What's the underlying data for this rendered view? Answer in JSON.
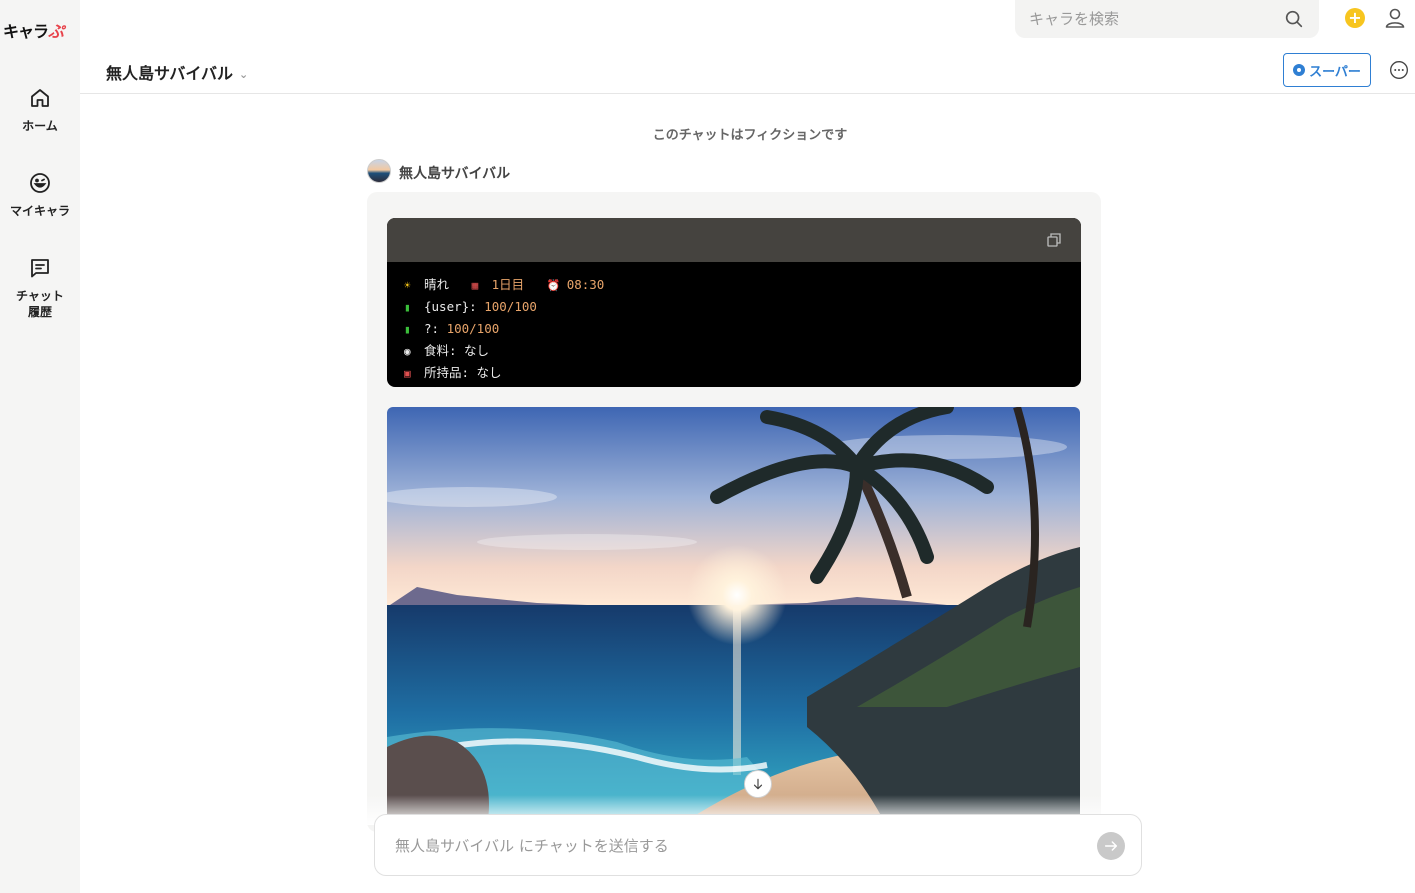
{
  "app": {
    "logo_main": "キャラ",
    "logo_accent": "ぷ"
  },
  "sidebar": {
    "items": [
      {
        "label": "ホーム",
        "icon": "home-icon"
      },
      {
        "label": "マイキャラ",
        "icon": "smile-icon"
      },
      {
        "label": "チャット\n履歴",
        "icon": "chat-history-icon"
      }
    ]
  },
  "search": {
    "placeholder": "キャラを検索",
    "value": ""
  },
  "header": {
    "chat_title": "無人島サバイバル",
    "super_label": "スーパー"
  },
  "chat": {
    "fiction_notice": "このチャットはフィクションです",
    "character_name": "無人島サバイバル",
    "status": [
      {
        "icon": "sun-icon",
        "parts": [
          {
            "t": "晴れ",
            "v": false
          },
          {
            "t": "  ",
            "v": false
          }
        ]
      },
      {
        "icon": "battery-icon",
        "parts": [
          {
            "t": "{user}: ",
            "v": false
          },
          {
            "t": "100/100",
            "v": true
          }
        ]
      },
      {
        "icon": "battery-icon",
        "parts": [
          {
            "t": "?: ",
            "v": false
          },
          {
            "t": "100/100",
            "v": true
          }
        ]
      },
      {
        "icon": "plate-icon",
        "parts": [
          {
            "t": "食料: なし",
            "v": false
          }
        ]
      },
      {
        "icon": "gift-icon",
        "parts": [
          {
            "t": "所持品: なし",
            "v": false
          }
        ]
      }
    ],
    "status_line1": {
      "weather": "晴れ",
      "day": "1日目",
      "time": "08:30"
    },
    "image_alt": "Tropical beach at sunrise with palm trees"
  },
  "composer": {
    "placeholder": "無人島サバイバル にチャットを送信する",
    "value": ""
  },
  "colors": {
    "accent_blue": "#2f7fd3",
    "code_value": "#e8a46a",
    "coin": "#f7c51f"
  }
}
